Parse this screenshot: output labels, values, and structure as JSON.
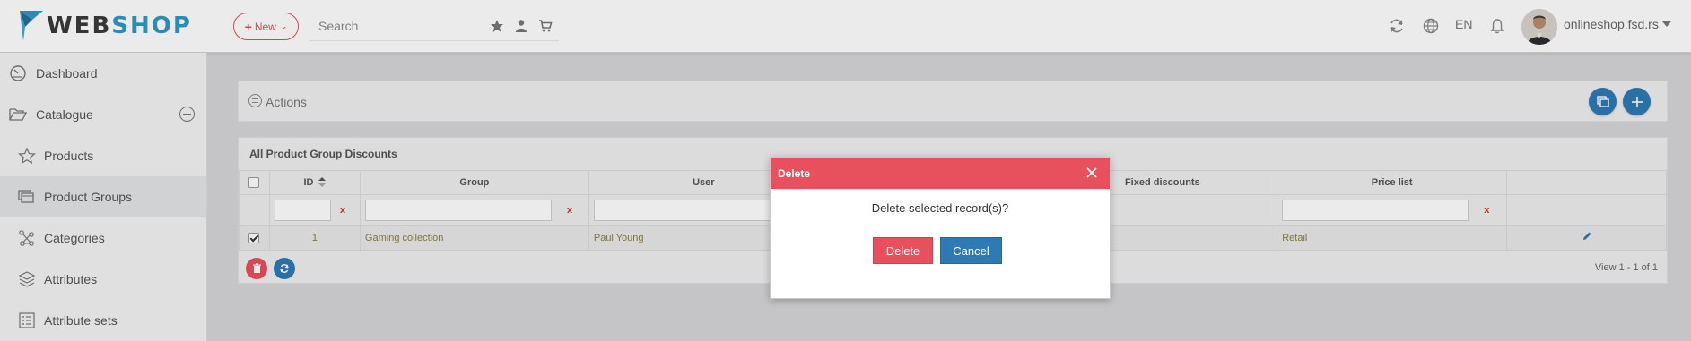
{
  "brand": {
    "web": "WEB",
    "shop": "SHOP"
  },
  "topbar": {
    "new_label": "New",
    "search_placeholder": "Search",
    "language": "EN",
    "user_name": "onlineshop.fsd.rs"
  },
  "sidebar": {
    "items": [
      {
        "label": "Dashboard",
        "icon": "dashboard-gauge-icon"
      },
      {
        "label": "Catalogue",
        "icon": "folder-open-icon"
      },
      {
        "label": "Products",
        "icon": "star-icon"
      },
      {
        "label": "Product Groups",
        "icon": "product-groups-icon",
        "active": true
      },
      {
        "label": "Categories",
        "icon": "categories-tree-icon"
      },
      {
        "label": "Attributes",
        "icon": "layers-icon"
      },
      {
        "label": "Attribute sets",
        "icon": "list-icon"
      }
    ]
  },
  "actions": {
    "label": "Actions"
  },
  "grid": {
    "title": "All Product Group Discounts",
    "columns": [
      "ID",
      "Group",
      "User",
      "Fixed discounts",
      "Price list"
    ],
    "rows": [
      {
        "id": "1",
        "group": "Gaming collection",
        "user": "Paul Young",
        "fixed_discounts": "",
        "price_list": "Retail",
        "checked": true
      }
    ],
    "view_count": "View 1 - 1 of 1"
  },
  "modal": {
    "title": "Delete",
    "message": "Delete selected record(s)?",
    "delete_label": "Delete",
    "cancel_label": "Cancel"
  },
  "colors": {
    "brand_blue": "#2e97c9",
    "danger": "#e8505d",
    "primary": "#2f7ab3",
    "data_text": "#8a7f3e"
  }
}
